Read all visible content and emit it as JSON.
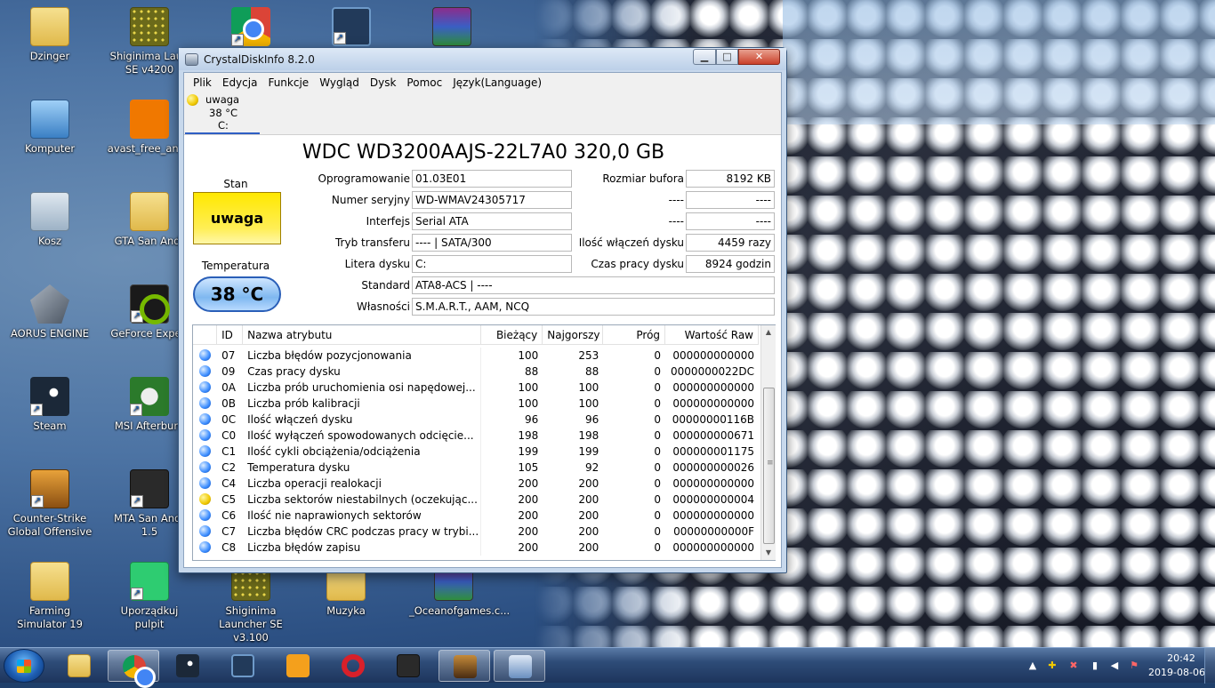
{
  "desktop": {
    "icons": [
      {
        "label": "Dzinger",
        "icon": "folder-user-icon"
      },
      {
        "label": "Shiginima Laun SE v4200",
        "icon": "minecraft-cube-icon"
      },
      {
        "label": "",
        "icon": "chrome-icon"
      },
      {
        "label": "",
        "icon": "headset-icon"
      },
      {
        "label": "",
        "icon": "winrar-icon"
      },
      {
        "label": "Komputer",
        "icon": "computer-icon"
      },
      {
        "label": "avast_free_antiv",
        "icon": "avast-icon"
      },
      {
        "label": "Kosz",
        "icon": "recycle-bin-icon"
      },
      {
        "label": "GTA San Andr",
        "icon": "folder-icon"
      },
      {
        "label": "AORUS ENGINE",
        "icon": "aorus-icon"
      },
      {
        "label": "GeForce Experi",
        "icon": "nvidia-icon"
      },
      {
        "label": "Steam",
        "icon": "steam-icon"
      },
      {
        "label": "MSI Afterburn",
        "icon": "msi-afterburner-icon"
      },
      {
        "label": "Counter-Strike Global Offensive",
        "icon": "csgo-icon"
      },
      {
        "label": "MTA San Andr 1.5",
        "icon": "mta-icon"
      },
      {
        "label": "Farming Simulator 19",
        "icon": "folder-icon"
      },
      {
        "label": "Uporządkuj pulpit",
        "icon": "tidy-desktop-icon"
      },
      {
        "label": "Shiginima Launcher SE v3.100",
        "icon": "minecraft-cube-icon"
      },
      {
        "label": "Muzyka",
        "icon": "folder-icon"
      },
      {
        "label": "_Oceanofgames.c...",
        "icon": "winrar-icon"
      }
    ]
  },
  "window": {
    "title": "CrystalDiskInfo 8.2.0",
    "min_label": "▁",
    "max_label": "□",
    "close_label": "✕",
    "menu": [
      "Plik",
      "Edycja",
      "Funkcje",
      "Wygląd",
      "Dysk",
      "Pomoc",
      "Język(Language)"
    ],
    "drive_tab": {
      "status": "uwaga",
      "temp": "38 °C",
      "letter": "C:"
    },
    "model": "WDC WD3200AAJS-22L7A0 320,0 GB",
    "stan_label": "Stan",
    "stan_value": "uwaga",
    "temp_label": "Temperatura",
    "temp_value": "38 °C",
    "fields": {
      "firmware_label": "Oprogramowanie",
      "firmware": "01.03E01",
      "serial_label": "Numer seryjny",
      "serial": "WD-WMAV24305717",
      "interface_label": "Interfejs",
      "interface": "Serial ATA",
      "transfer_label": "Tryb transferu",
      "transfer": "---- | SATA/300",
      "letter_label": "Litera dysku",
      "letter": "C:",
      "standard_label": "Standard",
      "standard": "ATA8-ACS | ----",
      "features_label": "Własności",
      "features": "S.M.A.R.T., AAM, NCQ",
      "buffer_label": "Rozmiar bufora",
      "buffer": "8192 KB",
      "blank1_label": "----",
      "blank1": "----",
      "blank2_label": "----",
      "blank2": "----",
      "poweron_count_label": "Ilość włączeń dysku",
      "poweron_count": "4459 razy",
      "poweron_hours_label": "Czas pracy dysku",
      "poweron_hours": "8924 godzin"
    },
    "smart": {
      "headers": [
        "",
        "ID",
        "Nazwa atrybutu",
        "Bieżący",
        "Najgorszy",
        "Próg",
        "Wartość Raw"
      ],
      "rows": [
        {
          "status": "blue",
          "id": "07",
          "name": "Liczba błędów pozycjonowania",
          "cur": "100",
          "worst": "253",
          "thr": "0",
          "raw": "000000000000"
        },
        {
          "status": "blue",
          "id": "09",
          "name": "Czas pracy dysku",
          "cur": "88",
          "worst": "88",
          "thr": "0",
          "raw": "0000000022DC"
        },
        {
          "status": "blue",
          "id": "0A",
          "name": "Liczba prób uruchomienia osi napędowej...",
          "cur": "100",
          "worst": "100",
          "thr": "0",
          "raw": "000000000000"
        },
        {
          "status": "blue",
          "id": "0B",
          "name": "Liczba prób kalibracji",
          "cur": "100",
          "worst": "100",
          "thr": "0",
          "raw": "000000000000"
        },
        {
          "status": "blue",
          "id": "0C",
          "name": "Ilość włączeń dysku",
          "cur": "96",
          "worst": "96",
          "thr": "0",
          "raw": "00000000116B"
        },
        {
          "status": "blue",
          "id": "C0",
          "name": "Ilość wyłączeń spowodowanych odcięcie...",
          "cur": "198",
          "worst": "198",
          "thr": "0",
          "raw": "000000000671"
        },
        {
          "status": "blue",
          "id": "C1",
          "name": "Ilość cykli obciążenia/odciążenia",
          "cur": "199",
          "worst": "199",
          "thr": "0",
          "raw": "000000001175"
        },
        {
          "status": "blue",
          "id": "C2",
          "name": "Temperatura dysku",
          "cur": "105",
          "worst": "92",
          "thr": "0",
          "raw": "000000000026"
        },
        {
          "status": "blue",
          "id": "C4",
          "name": "Liczba operacji realokacji",
          "cur": "200",
          "worst": "200",
          "thr": "0",
          "raw": "000000000000"
        },
        {
          "status": "yellow",
          "id": "C5",
          "name": "Liczba sektorów niestabilnych (oczekując...",
          "cur": "200",
          "worst": "200",
          "thr": "0",
          "raw": "000000000004"
        },
        {
          "status": "blue",
          "id": "C6",
          "name": "Ilość nie naprawionych sektorów",
          "cur": "200",
          "worst": "200",
          "thr": "0",
          "raw": "000000000000"
        },
        {
          "status": "blue",
          "id": "C7",
          "name": "Liczba błędów CRC podczas pracy w trybi...",
          "cur": "200",
          "worst": "200",
          "thr": "0",
          "raw": "00000000000F"
        },
        {
          "status": "blue",
          "id": "C8",
          "name": "Liczba błędów zapisu",
          "cur": "200",
          "worst": "200",
          "thr": "0",
          "raw": "000000000000"
        }
      ]
    }
  },
  "taskbar": {
    "apps": [
      {
        "icon": "explorer-icon",
        "active": false
      },
      {
        "icon": "chrome-icon",
        "active": true
      },
      {
        "icon": "steam-icon",
        "active": false
      },
      {
        "icon": "headset-icon",
        "active": false
      },
      {
        "icon": "farming-simulator-icon",
        "active": false
      },
      {
        "icon": "opera-icon",
        "active": false
      },
      {
        "icon": "mta-icon",
        "active": false
      },
      {
        "icon": "gta-sa-icon",
        "active": true
      },
      {
        "icon": "crystaldiskinfo-icon",
        "active": true
      }
    ],
    "tray": {
      "time": "20:42",
      "date": "2019-08-06"
    }
  }
}
